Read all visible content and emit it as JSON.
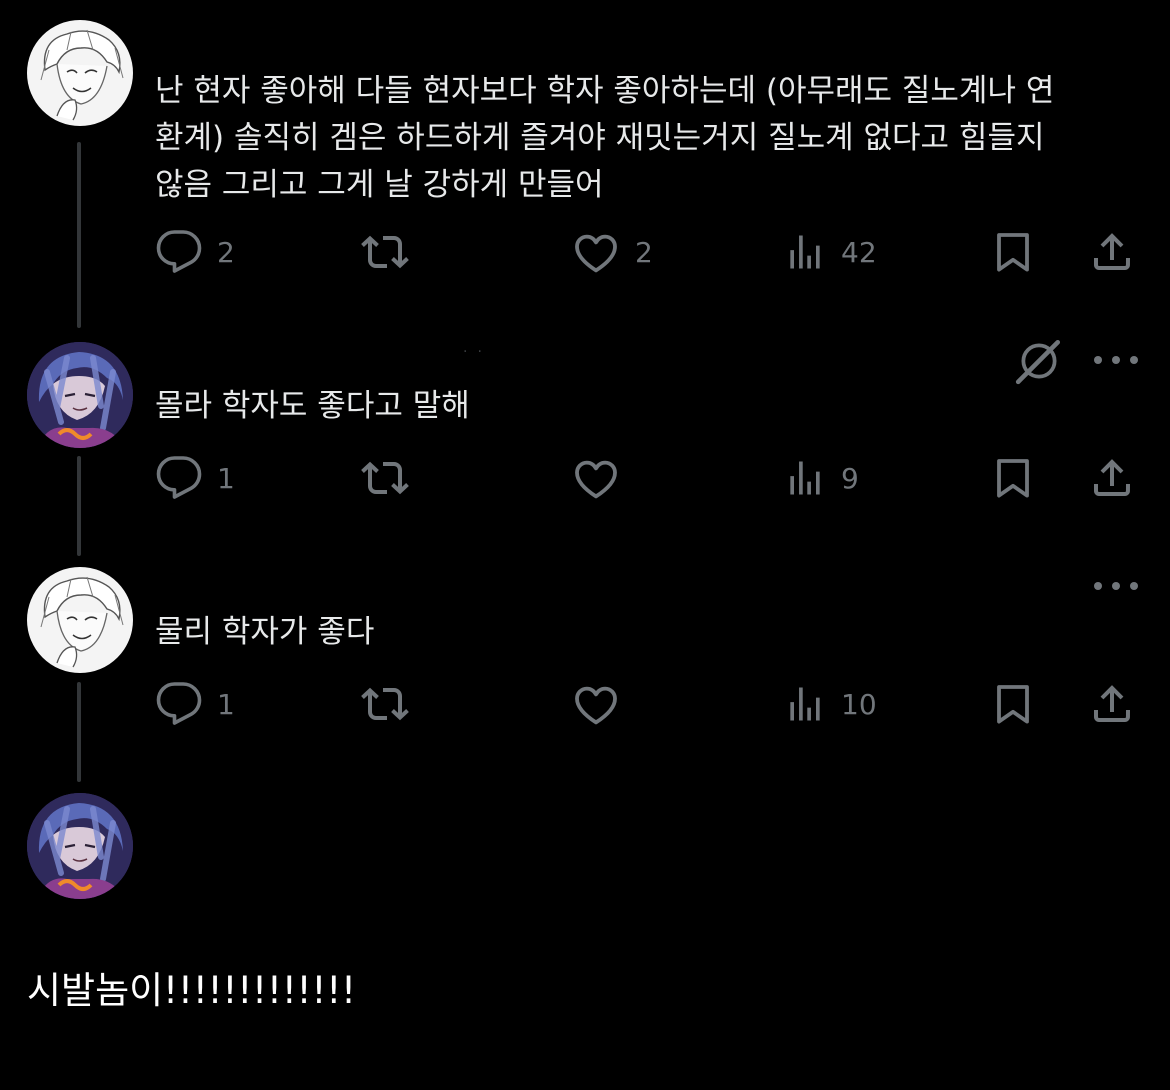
{
  "posts": [
    {
      "author": "user-a",
      "text": "난 현자 좋아해 다들 현자보다 학자 좋아하는데 (아무래도 질노계나 연\n환계) 솔직히 겜은 하드하게 즐겨야 재밋는거지 질노계 없다고 힘들지\n않음 그리고 그게 날 강하게 만들어",
      "replies": "2",
      "retweets": "",
      "likes": "2",
      "views": "42"
    },
    {
      "author": "user-b",
      "text": "몰라 학자도 좋다고 말해",
      "replies": "1",
      "retweets": "",
      "likes": "",
      "views": "9"
    },
    {
      "author": "user-a",
      "text": "물리 학자가 좋다",
      "replies": "1",
      "retweets": "",
      "likes": "",
      "views": "10"
    }
  ],
  "final_post": {
    "author": "user-b",
    "text": "시발놈이!!!!!!!!!!!!!"
  },
  "icons": {
    "reply": "reply-icon",
    "retweet": "retweet-icon",
    "like": "heart-icon",
    "views": "views-icon",
    "bookmark": "bookmark-icon",
    "share": "share-icon",
    "more": "more-icon",
    "grok": "grok-icon"
  },
  "colors": {
    "background": "#000000",
    "text": "#e7e9ea",
    "secondary": "#71767b",
    "thread_line": "#333639"
  }
}
